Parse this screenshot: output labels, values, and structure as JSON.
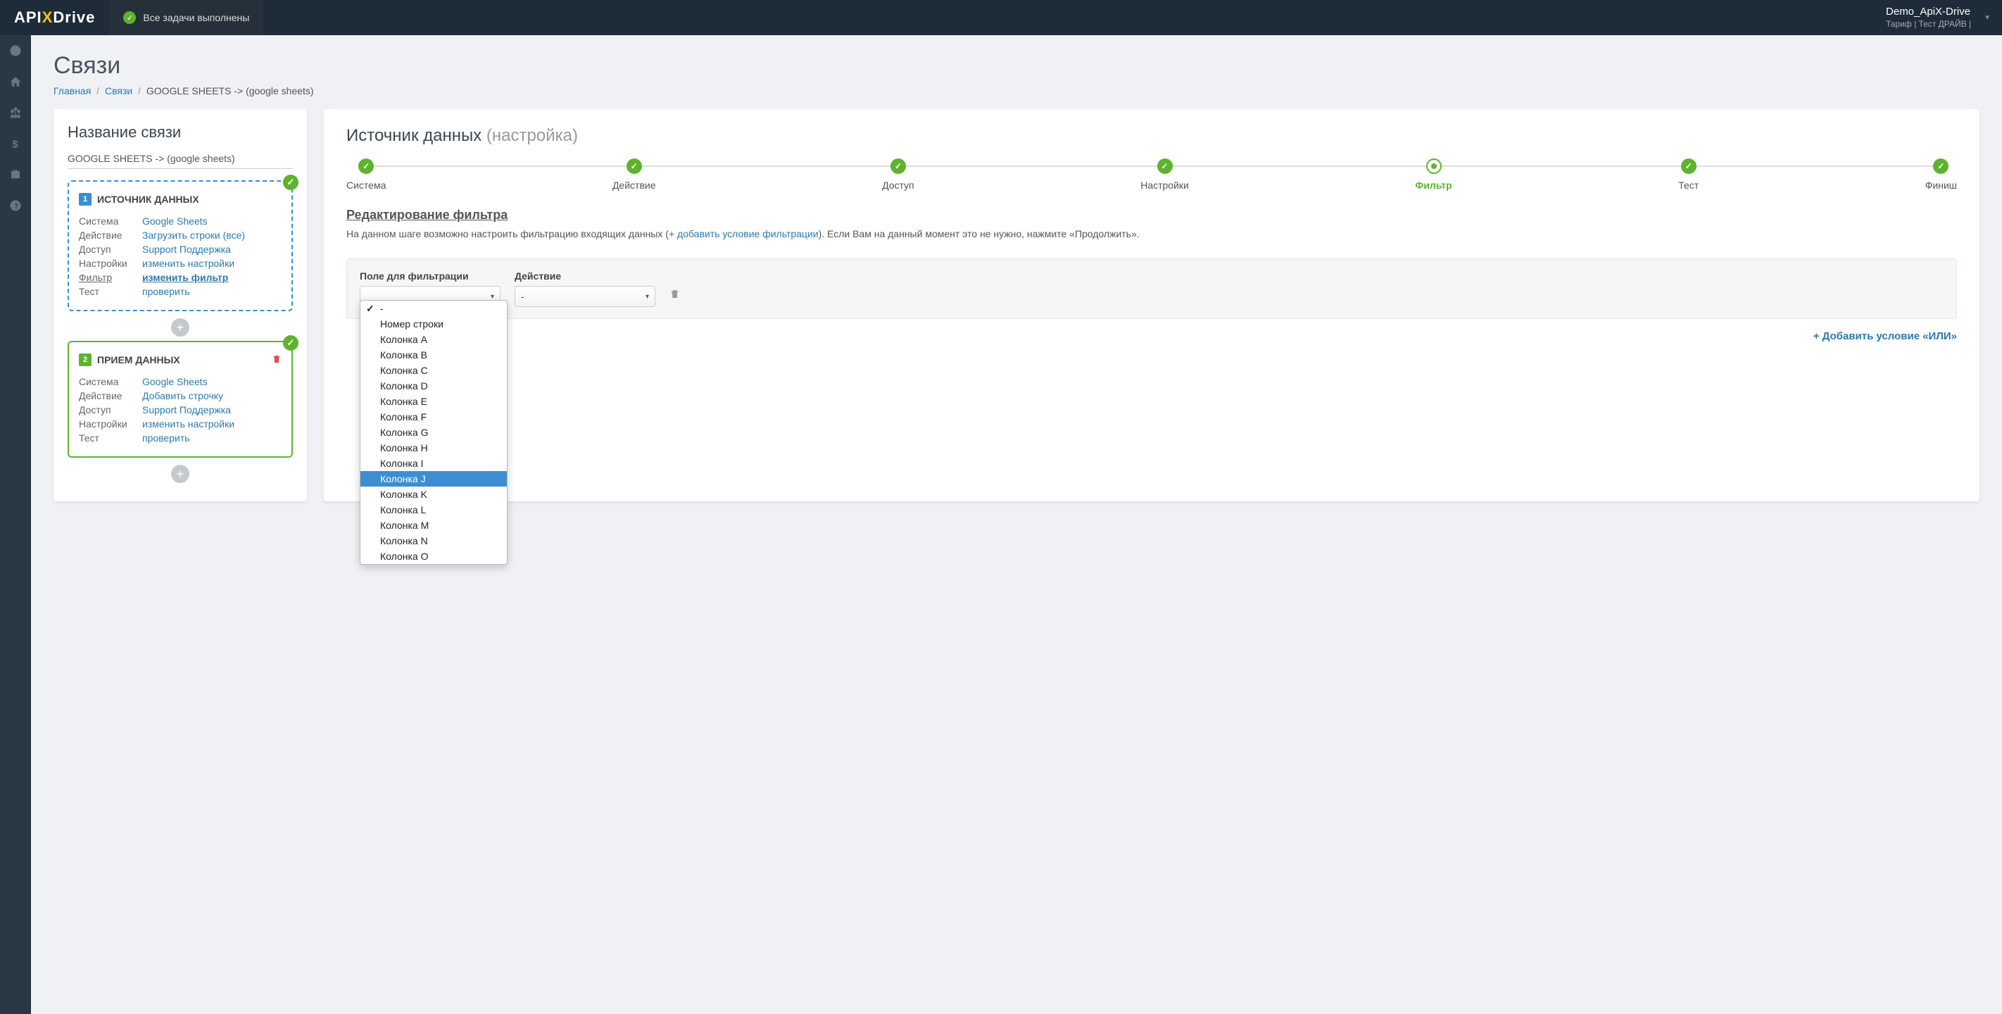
{
  "header": {
    "logo_api": "API",
    "logo_x": "X",
    "logo_drive": "Drive",
    "status_text": "Все задачи выполнены",
    "user_name": "Demo_ApiX-Drive",
    "user_tariff": "Тариф | Тест ДРАЙВ |"
  },
  "page": {
    "title": "Связи"
  },
  "breadcrumb": {
    "home": "Главная",
    "links": "Связи",
    "current": "GOOGLE SHEETS -> (google sheets)"
  },
  "left": {
    "title": "Название связи",
    "conn_name": "GOOGLE SHEETS -> (google sheets)",
    "block1": {
      "num": "1",
      "title": "ИСТОЧНИК ДАННЫХ",
      "rows": [
        {
          "label": "Система",
          "value": "Google Sheets"
        },
        {
          "label": "Действие",
          "value": "Загрузить строки (все)"
        },
        {
          "label": "Доступ",
          "value": "Support Поддержка"
        },
        {
          "label": "Настройки",
          "value": "изменить настройки"
        },
        {
          "label": "Фильтр",
          "value": "изменить фильтр"
        },
        {
          "label": "Тест",
          "value": "проверить"
        }
      ]
    },
    "block2": {
      "num": "2",
      "title": "ПРИЕМ ДАННЫХ",
      "rows": [
        {
          "label": "Система",
          "value": "Google Sheets"
        },
        {
          "label": "Действие",
          "value": "Добавить строчку"
        },
        {
          "label": "Доступ",
          "value": "Support Поддержка"
        },
        {
          "label": "Настройки",
          "value": "изменить настройки"
        },
        {
          "label": "Тест",
          "value": "проверить"
        }
      ]
    }
  },
  "right": {
    "title": "Источник данных",
    "subtitle": "(настройка)",
    "steps": [
      {
        "label": "Система",
        "state": "done"
      },
      {
        "label": "Действие",
        "state": "done"
      },
      {
        "label": "Доступ",
        "state": "done"
      },
      {
        "label": "Настройки",
        "state": "done"
      },
      {
        "label": "Фильтр",
        "state": "current"
      },
      {
        "label": "Тест",
        "state": "done"
      },
      {
        "label": "Финиш",
        "state": "done"
      }
    ],
    "section_head": "Редактирование фильтра",
    "desc_pre": "На данном шаге возможно настроить фильтрацию входящих данных (",
    "desc_link": "+ добавить условие фильтрации",
    "desc_post": "). Если Вам на данный момент это не нужно, нажмите «Продолжить».",
    "filter": {
      "col1_label": "Поле для фильтрации",
      "col2_label": "Действие",
      "col2_value": "-"
    },
    "dropdown": {
      "items": [
        {
          "label": "-",
          "checked": true
        },
        {
          "label": "Номер строки"
        },
        {
          "label": "Колонка A"
        },
        {
          "label": "Колонка B"
        },
        {
          "label": "Колонка C"
        },
        {
          "label": "Колонка D"
        },
        {
          "label": "Колонка E"
        },
        {
          "label": "Колонка F"
        },
        {
          "label": "Колонка G"
        },
        {
          "label": "Колонка H"
        },
        {
          "label": "Колонка I"
        },
        {
          "label": "Колонка J",
          "highlighted": true
        },
        {
          "label": "Колонка K"
        },
        {
          "label": "Колонка L"
        },
        {
          "label": "Колонка M"
        },
        {
          "label": "Колонка N"
        },
        {
          "label": "Колонка O"
        }
      ]
    },
    "add_or": "Добавить условие «ИЛИ»"
  }
}
